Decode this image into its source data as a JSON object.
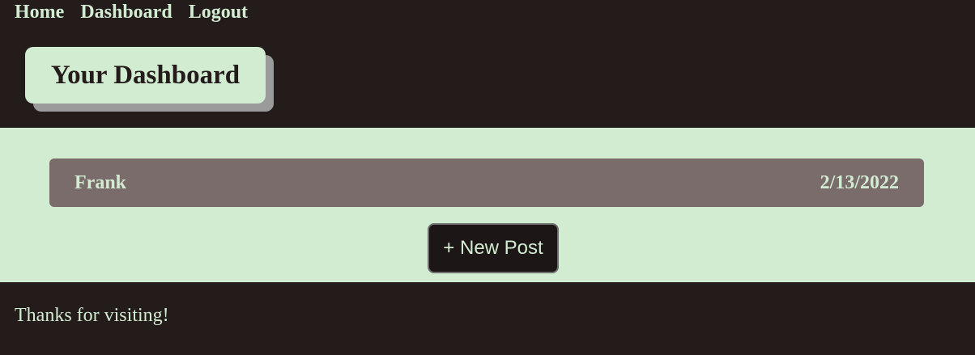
{
  "nav": {
    "items": [
      {
        "label": "Home"
      },
      {
        "label": "Dashboard"
      },
      {
        "label": "Logout"
      }
    ]
  },
  "header": {
    "title": "Your Dashboard"
  },
  "posts": [
    {
      "author": "Frank",
      "date": "2/13/2022"
    }
  ],
  "actions": {
    "new_post_label": "+ New Post"
  },
  "footer": {
    "text": "Thanks for visiting!"
  },
  "colors": {
    "dark": "#241c1b",
    "mint": "#d2ecd2",
    "card": "#7b6c6c",
    "shadow": "#9c9b9b"
  }
}
